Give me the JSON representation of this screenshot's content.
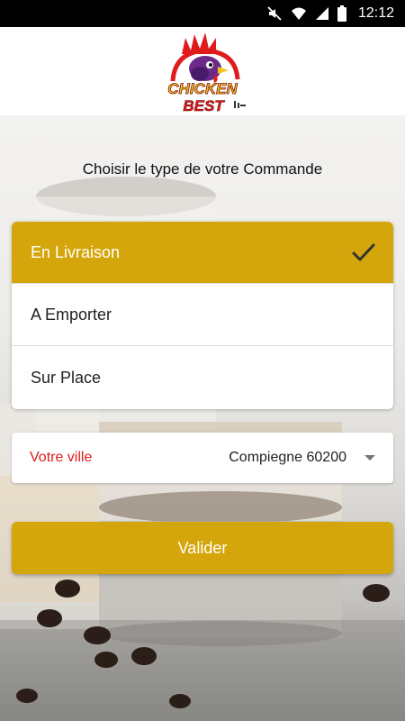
{
  "status_bar": {
    "time": "12:12",
    "icons": [
      "mute-icon",
      "wifi-icon",
      "signal-icon",
      "battery-icon"
    ]
  },
  "header": {
    "logo_line1": "CHICKEN",
    "logo_line2": "BEST"
  },
  "main": {
    "title": "Choisir le type de votre Commande",
    "order_types": [
      {
        "label": "En Livraison",
        "selected": true
      },
      {
        "label": "A Emporter",
        "selected": false
      },
      {
        "label": "Sur Place",
        "selected": false
      }
    ],
    "city": {
      "label": "Votre ville",
      "value": "Compiegne 60200"
    },
    "submit_label": "Valider"
  },
  "colors": {
    "accent": "#d4a60b",
    "city_label": "#e01b1b"
  }
}
